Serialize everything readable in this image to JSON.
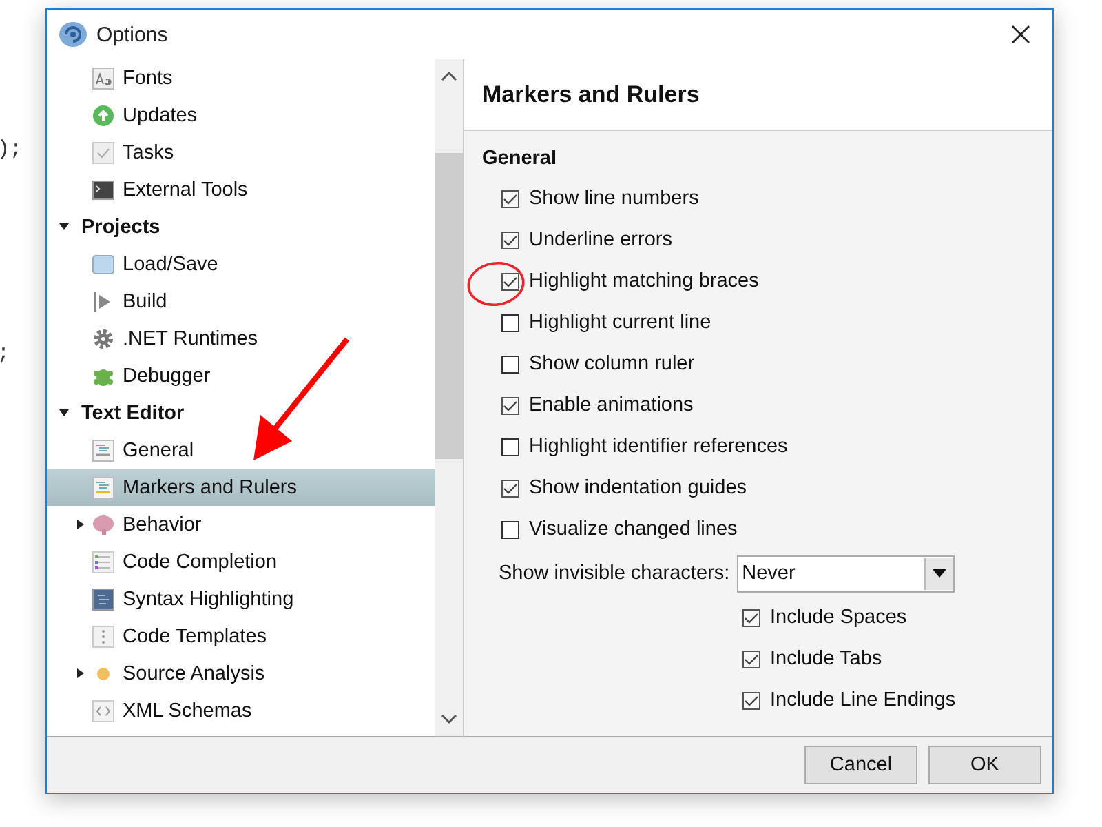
{
  "background_code": [
    ");",
    ";"
  ],
  "window": {
    "title": "Options"
  },
  "tree": [
    {
      "kind": "group",
      "children": [
        {
          "label": "Fonts",
          "kind": "leaf",
          "selected": false
        },
        {
          "label": "Updates",
          "kind": "leaf",
          "selected": false
        },
        {
          "label": "Tasks",
          "kind": "leaf",
          "selected": false
        },
        {
          "label": "External Tools",
          "kind": "leaf",
          "selected": false
        }
      ]
    },
    {
      "kind": "category",
      "label": "Projects",
      "expanded": true,
      "children": [
        {
          "label": "Load/Save",
          "kind": "leaf",
          "selected": false
        },
        {
          "label": "Build",
          "kind": "leaf",
          "selected": false
        },
        {
          "label": ".NET Runtimes",
          "kind": "leaf",
          "selected": false
        },
        {
          "label": "Debugger",
          "kind": "leaf",
          "selected": false
        }
      ]
    },
    {
      "kind": "category",
      "label": "Text Editor",
      "expanded": true,
      "children": [
        {
          "label": "General",
          "kind": "leaf",
          "selected": false
        },
        {
          "label": "Markers and Rulers",
          "kind": "leaf",
          "selected": true
        },
        {
          "label": "Behavior",
          "kind": "branch",
          "expanded": false,
          "selected": false
        },
        {
          "label": "Code Completion",
          "kind": "leaf",
          "selected": false
        },
        {
          "label": "Syntax Highlighting",
          "kind": "leaf",
          "selected": false
        },
        {
          "label": "Code Templates",
          "kind": "leaf",
          "selected": false
        },
        {
          "label": "Source Analysis",
          "kind": "branch",
          "expanded": false,
          "selected": false
        },
        {
          "label": "XML Schemas",
          "kind": "leaf",
          "selected": false
        }
      ]
    }
  ],
  "page": {
    "title": "Markers and Rulers",
    "section": "General",
    "options": [
      {
        "label": "Show line numbers",
        "checked": true
      },
      {
        "label": "Underline errors",
        "checked": true
      },
      {
        "label": "Highlight matching braces",
        "checked": true
      },
      {
        "label": "Highlight current line",
        "checked": false
      },
      {
        "label": "Show column ruler",
        "checked": false
      },
      {
        "label": "Enable animations",
        "checked": true
      },
      {
        "label": "Highlight identifier references",
        "checked": false
      },
      {
        "label": "Show indentation guides",
        "checked": true
      },
      {
        "label": "Visualize changed lines",
        "checked": false
      }
    ],
    "invisible": {
      "label": "Show invisible characters:",
      "value": "Never"
    },
    "sub_options": [
      {
        "label": "Include Spaces",
        "checked": true
      },
      {
        "label": "Include Tabs",
        "checked": true
      },
      {
        "label": "Include Line Endings",
        "checked": true
      }
    ]
  },
  "buttons": [
    "Cancel",
    "OK"
  ],
  "annotations": {
    "red_circle": true,
    "red_arrow": true
  }
}
